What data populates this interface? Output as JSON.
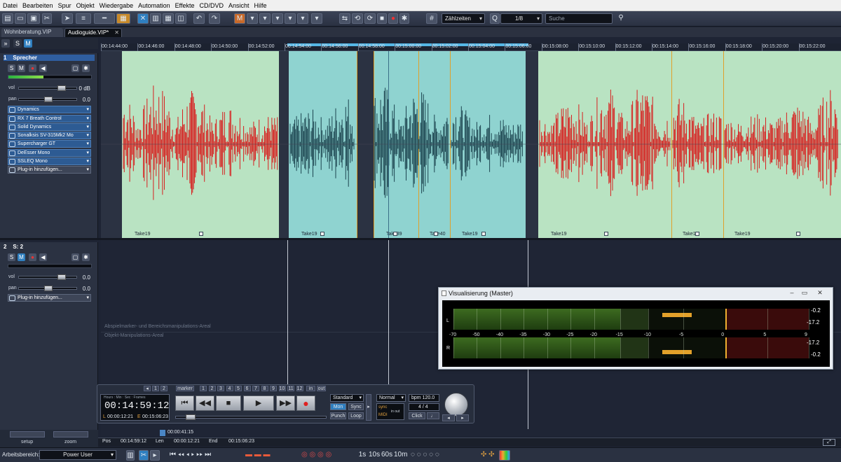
{
  "menu": [
    "Datei",
    "Bearbeiten",
    "Spur",
    "Objekt",
    "Wiedergabe",
    "Automation",
    "Effekte",
    "CD/DVD",
    "Ansicht",
    "Hilfe"
  ],
  "toolbar": {
    "counter_mode": "Zählzeiten",
    "grid_value": "1/8",
    "search_placeholder": "Suche"
  },
  "tabs": [
    {
      "label": "Wohnberatung.VIP",
      "active": false
    },
    {
      "label": "Audioguide.VIP*",
      "active": true
    }
  ],
  "header_buttons": {
    "expand": "»",
    "solo": "S",
    "mute": "M"
  },
  "ruler": {
    "ticks": [
      "00:14:44:00",
      "00:14:46:00",
      "00:14:48:00",
      "00:14:50:00",
      "00:14:52:00",
      "00:14:54:00",
      "00:14:56:00",
      "00:14:58:00",
      "00:15:00:00",
      "00:15:02:00",
      "00:15:04:00",
      "00:15:06:00",
      "00:15:08:00",
      "00:15:10:00",
      "00:15:12:00",
      "00:15:14:00",
      "00:15:16:00",
      "00:15:18:00",
      "00:15:20:00",
      "00:15:22:00"
    ]
  },
  "track1": {
    "number": "1",
    "name": "Sprecher",
    "solo": "S",
    "mute": "M",
    "vol_label": "vol",
    "vol_value": "0 dB",
    "pan_label": "pan",
    "pan_value": "0.0",
    "plugins": [
      "Dynamics",
      "RX 7 Breath Control",
      "Solid Dynamics",
      "Sonalksis SV-315Mk2 Mo",
      "Supercharger GT",
      "DeEsser Mono",
      "SSLEQ Mono"
    ],
    "add_plugin": "Plug-in hinzufügen...",
    "clips": [
      "Take19",
      "Take19",
      "Take39",
      "Take40",
      "Take19",
      "Take19",
      "Take19",
      "Take19"
    ]
  },
  "track2": {
    "number": "2",
    "name": "S: 2",
    "solo": "S",
    "mute": "M",
    "vol_label": "vol",
    "vol_value": "0.0",
    "pan_label": "pan",
    "pan_value": "0.0",
    "add_plugin": "Plug-in hinzufügen...",
    "area_label_1": "Abspielmarker- und Bereichsmanipulations-Areal",
    "area_label_2": "Objekt-Manipulations-Areal"
  },
  "transport": {
    "marker_label": "marker",
    "marker_numbers": [
      "1",
      "2",
      "3",
      "4",
      "5",
      "6",
      "7",
      "8",
      "9",
      "10",
      "11",
      "12"
    ],
    "left_numbers": [
      "1",
      "2"
    ],
    "in_label": "in",
    "out_label": "out",
    "time_format": "Hours : Min : Sec : Frames",
    "time": "00:14:59:12",
    "start_label": "L",
    "start_time": "00:00:12:21",
    "end_label": "E",
    "end_time": "00:15:06:23",
    "mode": "Standard",
    "mon": "Mon",
    "sync": "Sync",
    "punch": "Punch",
    "loop": "Loop",
    "play_mode": "Normal",
    "bpm_label": "bpm",
    "bpm": "120.0",
    "time_sig": "4 / 4",
    "sync_label": "sync",
    "midi_label": "MIDI",
    "in_out": "in out",
    "click": "Click"
  },
  "viz": {
    "title": "Visualisierung (Master)",
    "scale": [
      "-70",
      "-50",
      "-40",
      "-35",
      "-30",
      "-25",
      "-20",
      "-15",
      "-10",
      "-5",
      "0",
      "5",
      "9"
    ],
    "left_channel": "L",
    "right_channel": "R",
    "peak_l_top": "-0.2",
    "peak_l_bottom": "-17.2",
    "peak_r_top": "-17.2",
    "peak_r_bottom": "-0.2",
    "level_l_db": -15,
    "level_r_db": -15
  },
  "position_bar": {
    "marker_time": "00:00:41:15",
    "pos_label": "Pos",
    "pos": "00:14:59:12",
    "len_label": "Len",
    "len": "00:00:12:21",
    "end_label": "End",
    "end": "00:15:06:23"
  },
  "bottom": {
    "setup": "setup",
    "zoom": "zoom",
    "workspace_label": "Arbeitsbereich:",
    "workspace_value": "Power User",
    "zoom_buttons": [
      "1s",
      "10s",
      "60s",
      "10m"
    ]
  },
  "colors": {
    "clip_green": "#b8e4c0",
    "clip_teal": "#8fd3d0",
    "wave_red": "#d72020",
    "wave_dark": "#1d4550",
    "accent_blue": "#55b7e6"
  }
}
